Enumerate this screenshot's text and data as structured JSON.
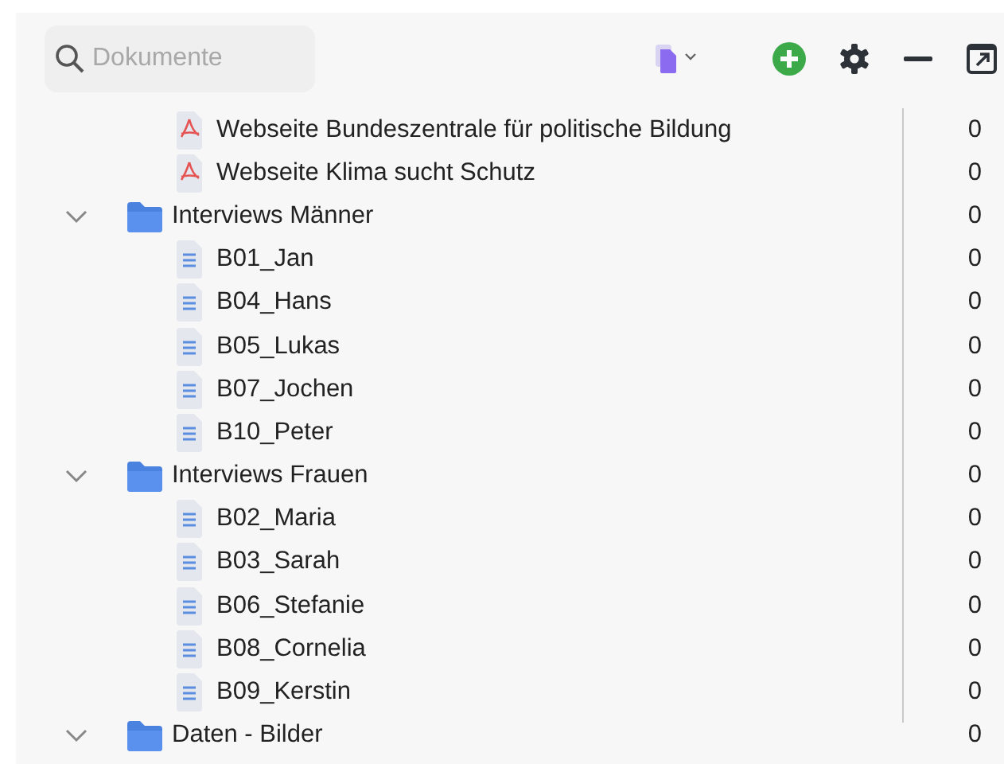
{
  "search": {
    "placeholder": "Dokumente"
  },
  "tree": [
    {
      "kind": "continued",
      "children": [
        {
          "kind": "pdf",
          "label": "Webseite Bundeszentrale für politische Bildung",
          "count": "0"
        },
        {
          "kind": "pdf",
          "label": "Webseite Klima sucht Schutz",
          "count": "0"
        }
      ]
    },
    {
      "kind": "folder",
      "label": "Interviews Männer",
      "count": "0",
      "expanded": true,
      "children": [
        {
          "kind": "text",
          "label": "B01_Jan",
          "count": "0"
        },
        {
          "kind": "text",
          "label": "B04_Hans",
          "count": "0"
        },
        {
          "kind": "text",
          "label": "B05_Lukas",
          "count": "0"
        },
        {
          "kind": "text",
          "label": "B07_Jochen",
          "count": "0"
        },
        {
          "kind": "text",
          "label": "B10_Peter",
          "count": "0"
        }
      ]
    },
    {
      "kind": "folder",
      "label": "Interviews Frauen",
      "count": "0",
      "expanded": true,
      "children": [
        {
          "kind": "text",
          "label": "B02_Maria",
          "count": "0"
        },
        {
          "kind": "text",
          "label": "B03_Sarah",
          "count": "0"
        },
        {
          "kind": "text",
          "label": "B06_Stefanie",
          "count": "0"
        },
        {
          "kind": "text",
          "label": "B08_Cornelia",
          "count": "0"
        },
        {
          "kind": "text",
          "label": "B09_Kerstin",
          "count": "0"
        }
      ]
    },
    {
      "kind": "folder",
      "label": "Daten - Bilder",
      "count": "0",
      "expanded": true
    }
  ]
}
